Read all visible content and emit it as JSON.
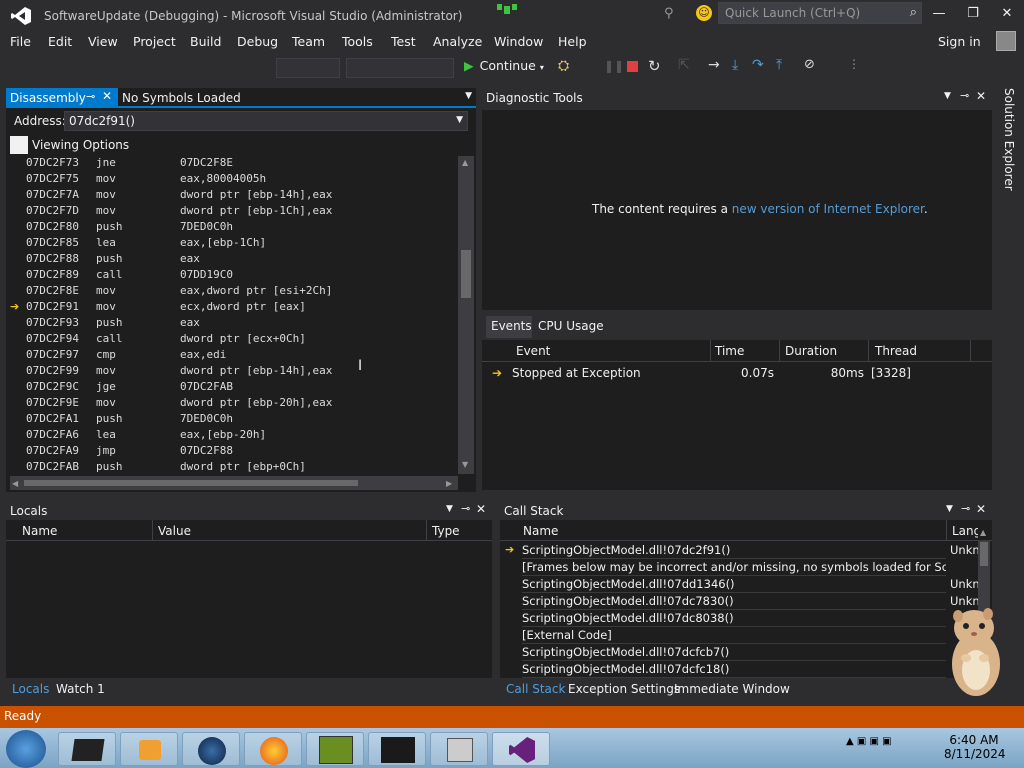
{
  "window": {
    "title": "SoftwareUpdate (Debugging) - Microsoft Visual Studio (Administrator)",
    "quick_launch_placeholder": "Quick Launch (Ctrl+Q)",
    "minimize": "—",
    "restore": "❐",
    "close": "✕"
  },
  "menu": [
    "File",
    "Edit",
    "View",
    "Project",
    "Build",
    "Debug",
    "Team",
    "Tools",
    "Test",
    "Analyze",
    "Window",
    "Help"
  ],
  "sign_in": "Sign in",
  "toolbar": {
    "continue_label": "Continue"
  },
  "disassembly": {
    "tab_label": "Disassembly",
    "symbols_label": "No Symbols Loaded",
    "address_label": "Address:",
    "address_value": "07dc2f91()",
    "viewing_options": "Viewing Options",
    "lines": [
      {
        "addr": "07DC2F73",
        "op": "jne",
        "args": "07DC2F8E",
        "current": false
      },
      {
        "addr": "07DC2F75",
        "op": "mov",
        "args": "eax,80004005h",
        "current": false
      },
      {
        "addr": "07DC2F7A",
        "op": "mov",
        "args": "dword ptr [ebp-14h],eax",
        "current": false
      },
      {
        "addr": "07DC2F7D",
        "op": "mov",
        "args": "dword ptr [ebp-1Ch],eax",
        "current": false
      },
      {
        "addr": "07DC2F80",
        "op": "push",
        "args": "7DED0C0h",
        "current": false
      },
      {
        "addr": "07DC2F85",
        "op": "lea",
        "args": "eax,[ebp-1Ch]",
        "current": false
      },
      {
        "addr": "07DC2F88",
        "op": "push",
        "args": "eax",
        "current": false
      },
      {
        "addr": "07DC2F89",
        "op": "call",
        "args": "07DD19C0",
        "current": false
      },
      {
        "addr": "07DC2F8E",
        "op": "mov",
        "args": "eax,dword ptr [esi+2Ch]",
        "current": false
      },
      {
        "addr": "07DC2F91",
        "op": "mov",
        "args": "ecx,dword ptr [eax]",
        "current": true
      },
      {
        "addr": "07DC2F93",
        "op": "push",
        "args": "eax",
        "current": false
      },
      {
        "addr": "07DC2F94",
        "op": "call",
        "args": "dword ptr [ecx+0Ch]",
        "current": false
      },
      {
        "addr": "07DC2F97",
        "op": "cmp",
        "args": "eax,edi",
        "current": false
      },
      {
        "addr": "07DC2F99",
        "op": "mov",
        "args": "dword ptr [ebp-14h],eax",
        "current": false
      },
      {
        "addr": "07DC2F9C",
        "op": "jge",
        "args": "07DC2FAB",
        "current": false
      },
      {
        "addr": "07DC2F9E",
        "op": "mov",
        "args": "dword ptr [ebp-20h],eax",
        "current": false
      },
      {
        "addr": "07DC2FA1",
        "op": "push",
        "args": "7DED0C0h",
        "current": false
      },
      {
        "addr": "07DC2FA6",
        "op": "lea",
        "args": "eax,[ebp-20h]",
        "current": false
      },
      {
        "addr": "07DC2FA9",
        "op": "jmp",
        "args": "07DC2F88",
        "current": false
      },
      {
        "addr": "07DC2FAB",
        "op": "push",
        "args": "dword ptr [ebp+0Ch]",
        "current": false
      }
    ]
  },
  "diagnostic": {
    "title": "Diagnostic Tools",
    "message_prefix": "The content requires a ",
    "message_link": "new version of Internet Explorer",
    "message_suffix": ".",
    "tab_events": "Events",
    "tab_cpu": "CPU Usage",
    "columns": [
      "Event",
      "Time",
      "Duration",
      "Thread"
    ],
    "events": [
      {
        "event": "Stopped at Exception",
        "time": "0.07s",
        "duration": "80ms",
        "thread": "[3328]"
      }
    ]
  },
  "solution_explorer": "Solution Explorer",
  "locals": {
    "title": "Locals",
    "columns": [
      "Name",
      "Value",
      "Type"
    ],
    "tab_locals": "Locals",
    "tab_watch": "Watch 1"
  },
  "call_stack": {
    "title": "Call Stack",
    "columns": [
      "Name",
      "Lang"
    ],
    "rows": [
      {
        "name": "ScriptingObjectModel.dll!07dc2f91()",
        "lang": "Unkn",
        "current": true
      },
      {
        "name": "[Frames below may be incorrect and/or missing, no symbols loaded for ScriptingObjectModel.dll]",
        "lang": "",
        "current": false
      },
      {
        "name": "ScriptingObjectModel.dll!07dd1346()",
        "lang": "Unkn",
        "current": false
      },
      {
        "name": "ScriptingObjectModel.dll!07dc7830()",
        "lang": "Unkn",
        "current": false
      },
      {
        "name": "ScriptingObjectModel.dll!07dc8038()",
        "lang": "",
        "current": false
      },
      {
        "name": "[External Code]",
        "lang": "",
        "current": false
      },
      {
        "name": "ScriptingObjectModel.dll!07dcfcb7()",
        "lang": "",
        "current": false
      },
      {
        "name": "ScriptingObjectModel.dll!07dcfc18()",
        "lang": "",
        "current": false
      }
    ],
    "tab_call_stack": "Call Stack",
    "tab_exception": "Exception Settings",
    "tab_immediate": "Immediate Window"
  },
  "status": "Ready",
  "clock": {
    "time": "6:40 AM",
    "date": "8/11/2024"
  },
  "colors": {
    "accent": "#007acc",
    "status_bar": "#ca5100",
    "link": "#569cd6",
    "arrow": "#f5c518"
  }
}
